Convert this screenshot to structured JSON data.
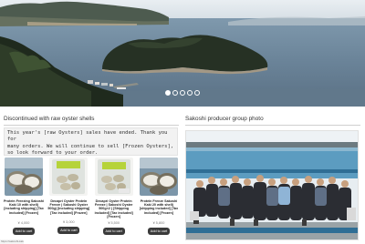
{
  "carousel": {
    "slide_count": 5,
    "active_index": 0
  },
  "sections": {
    "left_title": "Discontinued with raw oyster shells",
    "right_title": "Sakoshi producer group photo"
  },
  "notice": {
    "text": "This year's [raw Oysters] sales have ended. Thank you for\nmany orders. We will continue to sell [Frozen Oysters],\nso look forward to your order."
  },
  "products": [
    {
      "name": "Protein Freezing Sakoshi Kaki 10 with shell) [including shipping] [Tax included] [Frozen]",
      "price": "¥ 4,000",
      "cart_label": "Add to cart"
    },
    {
      "name": "Decapri Oyster Protein Freeze | Sakoshi Oyster 500g) [including shipping] [Tax included] [Frozen]",
      "price": "¥ 3,000",
      "cart_label": "Add to cart"
    },
    {
      "name": "Decapri Oyster Protein Freeze | Sakoshi Oyster 500g×2 ) [Shipping included] [Tax included] [Frozen]",
      "price": "¥ 5,500",
      "cart_label": "Add to cart"
    },
    {
      "name": "Protein Freeze Sakoshi Kaki 20 with shell) [shipping included] [Tax included] [Frozen]",
      "price": "¥ 5,800",
      "cart_label": "Add to cart"
    }
  ],
  "status_bar": {
    "text": "https://sakoshi-kaki..."
  },
  "colors": {
    "button": "#3a3a3a",
    "notice_bg": "#f2f2f2",
    "rule": "#cfcfcf"
  }
}
